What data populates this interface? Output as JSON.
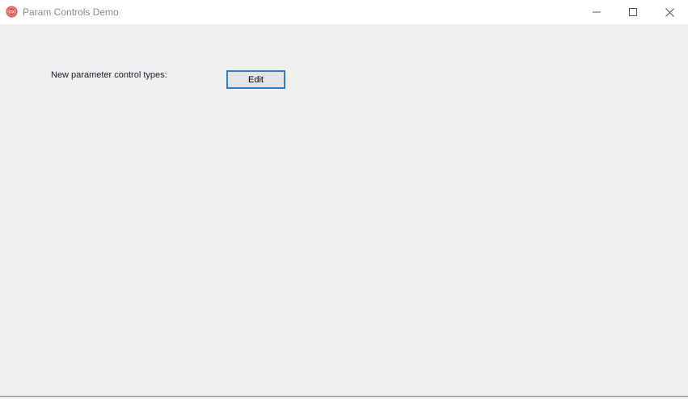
{
  "window": {
    "title": "Param Controls Demo",
    "icon": "app-logo-icon",
    "controls": {
      "minimize": "minimize-icon",
      "maximize": "maximize-icon",
      "close": "close-icon"
    }
  },
  "main": {
    "label": "New parameter control types:",
    "edit_button_label": "Edit"
  },
  "colors": {
    "client_background": "#f0f0ee",
    "titlebar_background": "#ffffff",
    "button_focus_border": "#2f7dd1",
    "button_background": "#e5e5e5",
    "app_icon": "#d9534f"
  }
}
